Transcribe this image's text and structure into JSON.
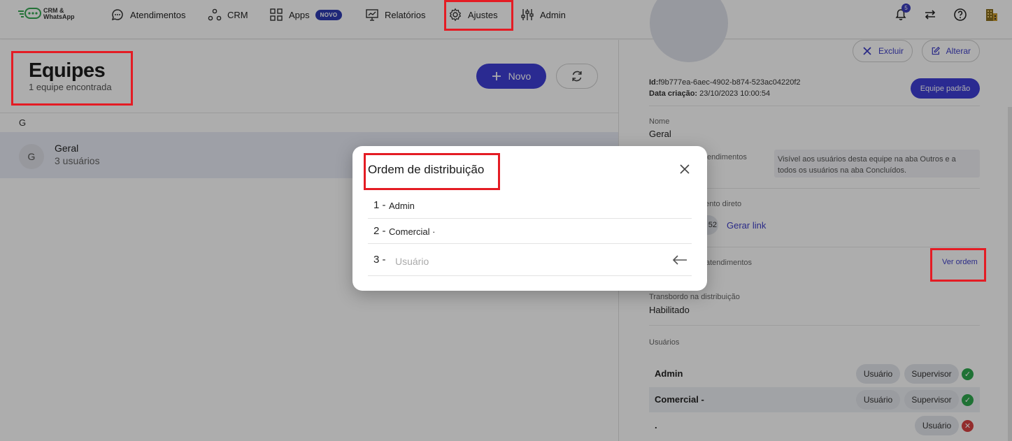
{
  "brand": {
    "logo_text": "CRM & WhatsApp"
  },
  "nav": {
    "items": [
      {
        "label": "Atendimentos",
        "icon": "chat-bubble-icon"
      },
      {
        "label": "CRM",
        "icon": "nodes-icon"
      },
      {
        "label": "Apps",
        "icon": "grid-icon",
        "badge": "NOVO"
      },
      {
        "label": "Relatórios",
        "icon": "presentation-chart-icon"
      },
      {
        "label": "Ajustes",
        "icon": "gear-icon"
      },
      {
        "label": "Admin",
        "icon": "sliders-icon"
      }
    ],
    "notifications_count": "5"
  },
  "page": {
    "title": "Equipes",
    "subtitle": "1 equipe encontrada",
    "new_button": "Novo",
    "group_letter": "G",
    "team": {
      "avatar_letter": "G",
      "name": "Geral",
      "users": "3 usuários"
    }
  },
  "detail": {
    "delete_label": "Excluir",
    "edit_label": "Alterar",
    "id_label": "Id:",
    "id_value": "f9b777ea-6aec-4902-b874-523ac04220f2",
    "created_label": "Data criação:",
    "created_value": "23/10/2023 10:00:54",
    "default_team_button": "Equipe padrão",
    "name_label": "Nome",
    "name_value": "Geral",
    "visibility_label_partial": "endimentos",
    "visibility_text": "Visível aos usuários desta equipe na aba Outros e a todos os usuários na aba Concluídos.",
    "direct_link_label_partial": "mento direto",
    "direct_link_value_partial": "52",
    "generate_link": "Gerar link",
    "distribution_label_partial": "atendimentos",
    "view_order_link": "Ver ordem",
    "overflow_label": "Transbordo na distribuição",
    "overflow_value": "Habilitado",
    "users_label": "Usuários",
    "users": [
      {
        "name": "Admin",
        "roles": [
          "Usuário",
          "Supervisor"
        ],
        "status": "active"
      },
      {
        "name": "Comercial -",
        "roles": [
          "Usuário",
          "Supervisor"
        ],
        "status": "active"
      },
      {
        "name": ".",
        "roles": [
          "Usuário"
        ],
        "status": "inactive"
      }
    ]
  },
  "modal": {
    "title": "Ordem de distribuição",
    "rows": [
      {
        "num": "1 -",
        "name": "Admin"
      },
      {
        "num": "2 -",
        "name": "Comercial ·"
      }
    ],
    "input_row": {
      "num": "3 -",
      "placeholder": "Usuário",
      "value": ""
    }
  },
  "colors": {
    "accent": "#3f3fd6",
    "highlight": "#e41c24",
    "success": "#2fa84f",
    "danger": "#d94141"
  }
}
